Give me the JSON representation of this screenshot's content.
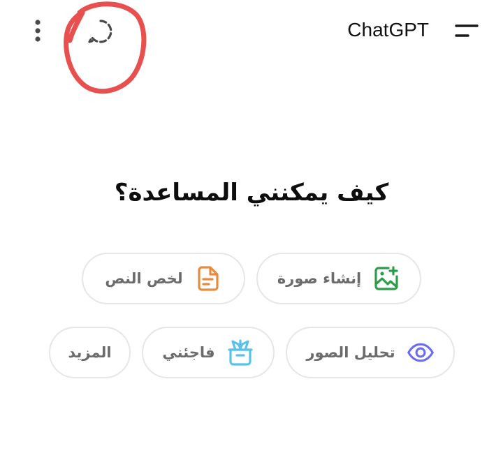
{
  "header": {
    "title": "ChatGPT",
    "more_icon": "more-vertical-icon",
    "temporary_chat_icon": "dashed-circle-chat-icon",
    "menu_icon": "menu-icon"
  },
  "main": {
    "greeting": "كيف يمكنني المساعدة؟"
  },
  "suggestions": [
    {
      "label": "إنشاء صورة",
      "icon": "image-create-icon",
      "color": "#2e9d4b"
    },
    {
      "label": "لخص النص",
      "icon": "document-icon",
      "color": "#e98b3e"
    },
    {
      "label": "تحليل الصور",
      "icon": "eye-icon",
      "color": "#6b6cf0"
    },
    {
      "label": "فاجئني",
      "icon": "gift-box-icon",
      "color": "#5ac2e8"
    },
    {
      "label": "المزيد",
      "icon": "",
      "color": "#6b6b6b"
    }
  ],
  "colors": {
    "annotation_ring": "#e8504f",
    "chip_border": "#e6e6e6",
    "chip_text": "#6b6b6b"
  }
}
